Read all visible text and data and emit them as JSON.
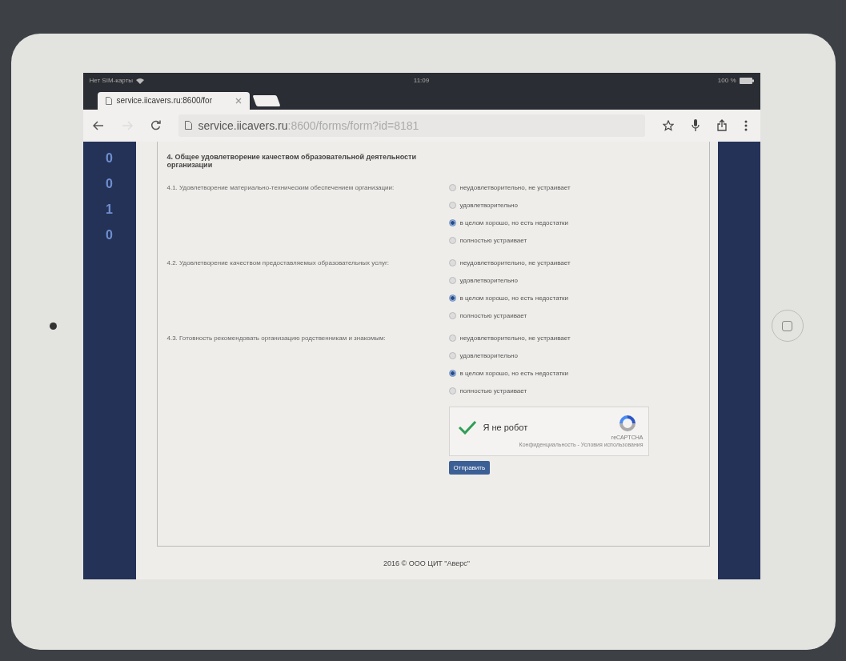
{
  "status_bar": {
    "carrier": "Нет SIM-карты",
    "time": "11:09",
    "battery": "100 %"
  },
  "browser": {
    "tabs": [
      {
        "title": "service.iicavers.ru:8600/for",
        "selected": true
      }
    ],
    "url_host": "service.iicavers.ru",
    "url_path": ":8600/forms/form?id=8181"
  },
  "side_digits": [
    "0",
    "0",
    "1",
    "0"
  ],
  "section_title": "4. Общее удовлетворение качеством образовательной деятельности организации",
  "questions": [
    {
      "label": "4.1. Удовлетворение материально-техническим обеспечением организации:",
      "options": [
        {
          "label": "неудовлетворительно, не устраивает",
          "selected": false
        },
        {
          "label": "удовлетворительно",
          "selected": false
        },
        {
          "label": "в целом хорошо, но есть недостатки",
          "selected": true
        },
        {
          "label": "полностью устраивает",
          "selected": false
        }
      ]
    },
    {
      "label": "4.2. Удовлетворение качеством предоставляемых образовательных услуг:",
      "options": [
        {
          "label": "неудовлетворительно, не устраивает",
          "selected": false
        },
        {
          "label": "удовлетворительно",
          "selected": false
        },
        {
          "label": "в целом хорошо, но есть недостатки",
          "selected": true
        },
        {
          "label": "полностью устраивает",
          "selected": false
        }
      ]
    },
    {
      "label": "4.3. Готовность рекомендовать организацию родственникам и знакомым:",
      "options": [
        {
          "label": "неудовлетворительно, не устраивает",
          "selected": false
        },
        {
          "label": "удовлетворительно",
          "selected": false
        },
        {
          "label": "в целом хорошо, но есть недостатки",
          "selected": true
        },
        {
          "label": "полностью устраивает",
          "selected": false
        }
      ]
    }
  ],
  "captcha": {
    "checked": true,
    "label": "Я не робот",
    "brand": "reCAPTCHA",
    "links": "Конфиденциальность - Условия использования"
  },
  "submit_button": "Отправить",
  "footer": "2016 © ООО ЦИТ \"Аверс\""
}
